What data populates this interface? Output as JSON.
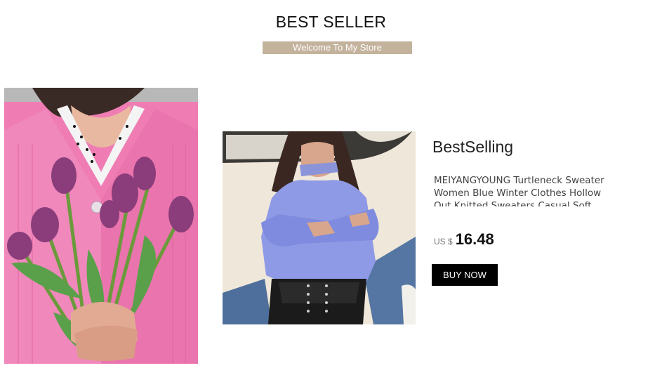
{
  "header": {
    "title": "BEST SELLER",
    "banner": "Welcome To My Store"
  },
  "product": {
    "title": "BestSelling",
    "description": "MEIYANGYOUNG Turtleneck Sweater Women Blue Winter Clothes Hollow Out Knitted Sweaters Casual Soft Fluffy",
    "currency": "US $",
    "price": "16.48",
    "buy_label": "BUY NOW"
  },
  "colors": {
    "banner_bg": "#c3b29c",
    "button_bg": "#000000",
    "sweater_pink": "#f07fb6",
    "sweater_blue": "#8f9ae6"
  }
}
